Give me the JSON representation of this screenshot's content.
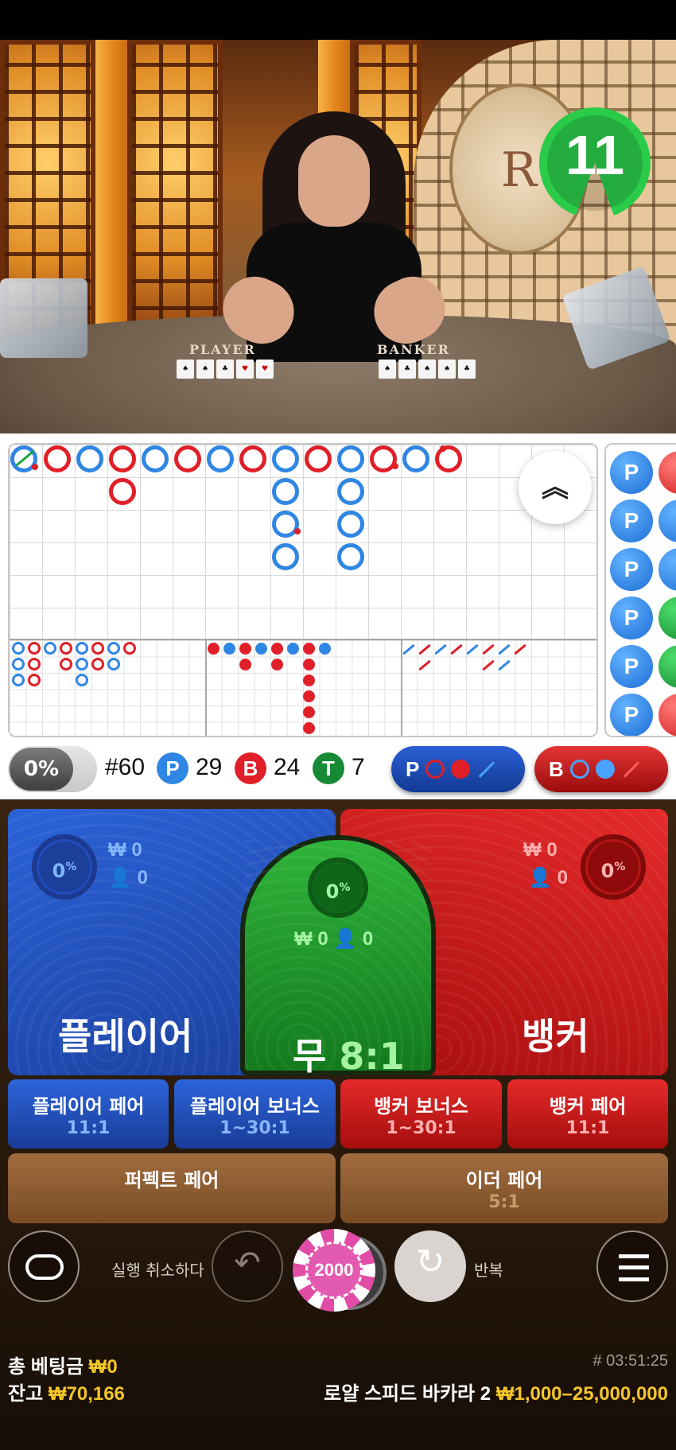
{
  "video": {
    "countdown": "11",
    "table_labels": {
      "player": "PLAYER",
      "banker": "BANKER"
    },
    "logo_letter": "R"
  },
  "roadmap": {
    "collapse_icon": "chevron-double-up-icon",
    "bead_plate": [
      "P",
      "P",
      "P",
      "P",
      "P",
      "P"
    ]
  },
  "stats": {
    "percent": "0%",
    "round": "#60",
    "player_symbol": "P",
    "player_count": "29",
    "banker_symbol": "B",
    "banker_count": "24",
    "tie_symbol": "T",
    "tie_count": "7",
    "player_ask": "P",
    "banker_ask": "B",
    "colors": {
      "player": "#2f86e3",
      "banker": "#e01f28",
      "tie": "#168a34"
    }
  },
  "bets": {
    "player": {
      "percent": "0",
      "amount": "₩ 0",
      "players": "0",
      "label": "플레이어"
    },
    "tie": {
      "percent": "0",
      "amount": "₩ 0",
      "players": "0",
      "label": "무",
      "odds": "8:1"
    },
    "banker": {
      "percent": "0",
      "amount": "₩ 0",
      "players": "0",
      "label": "뱅커"
    },
    "percent_sign": "%",
    "side": [
      {
        "name": "플레이어 페어",
        "odds": "11:1"
      },
      {
        "name": "플레이어 보너스",
        "odds": "1~30:1"
      },
      {
        "name": "뱅커 보너스",
        "odds": "1~30:1"
      },
      {
        "name": "뱅커 페어",
        "odds": "11:1"
      }
    ],
    "perfect_pair": {
      "name": "퍼펙트 페어"
    },
    "either_pair": {
      "name": "이더 페어",
      "odds": "5:1"
    }
  },
  "controls": {
    "undo_label": "실행 취소하다",
    "chip_value": "2000",
    "repeat_label": "반복"
  },
  "footer": {
    "total_bet_label": "총 베팅금",
    "total_bet_value": "₩0",
    "balance_label": "잔고",
    "balance_value": "₩70,166",
    "game_id": "# 03:51:25",
    "table_name": "로얄 스피드 바카라 2",
    "limits": "₩1,000–25,000,000"
  }
}
